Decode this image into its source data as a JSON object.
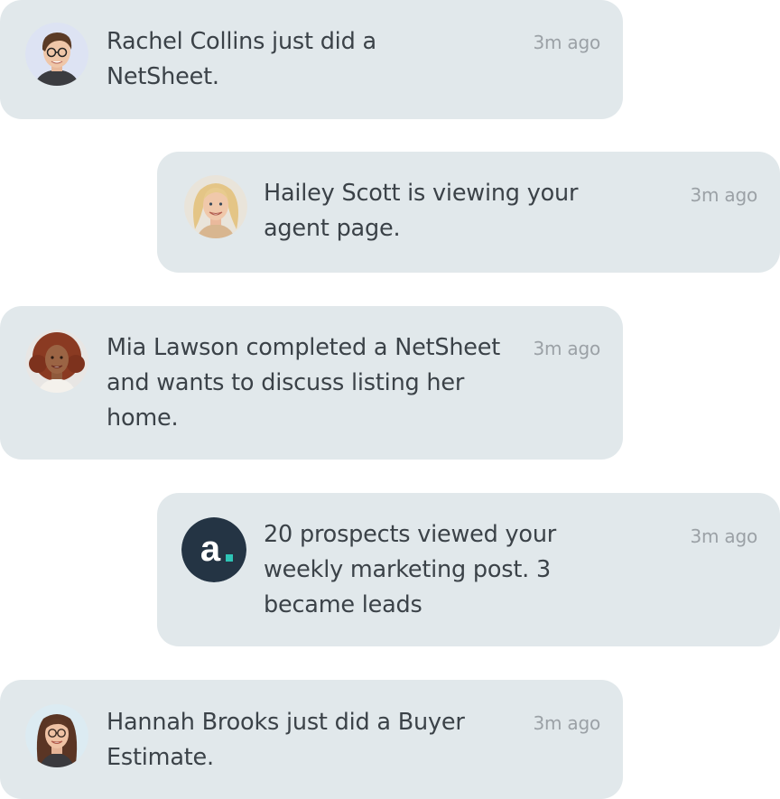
{
  "notifications": [
    {
      "avatar": "woman-short-hair-glasses-avatar",
      "text": "Rachel Collins just did a NetSheet.",
      "time": "3m ago"
    },
    {
      "avatar": "woman-blonde-hair-avatar",
      "text": "Hailey Scott is viewing your agent page.",
      "time": "3m ago"
    },
    {
      "avatar": "woman-curly-red-hair-avatar",
      "text": "Mia Lawson completed a NetSheet and wants to discuss listing her home.",
      "time": "3m ago"
    },
    {
      "avatar": "brand-logo-a",
      "text": "20 prospects viewed your weekly marketing post. 3 became leads",
      "time": "3m ago",
      "logo_letter": "a",
      "logo_colors": {
        "bg": "#243444",
        "dot": "#2ec4b6"
      }
    },
    {
      "avatar": "woman-long-brown-hair-glasses-avatar",
      "text": "Hannah Brooks just did a Buyer Estimate.",
      "time": "3m ago"
    }
  ],
  "colors": {
    "card_bg": "#e1e8eb",
    "text": "#3b4248",
    "time": "#9ba1a6"
  }
}
